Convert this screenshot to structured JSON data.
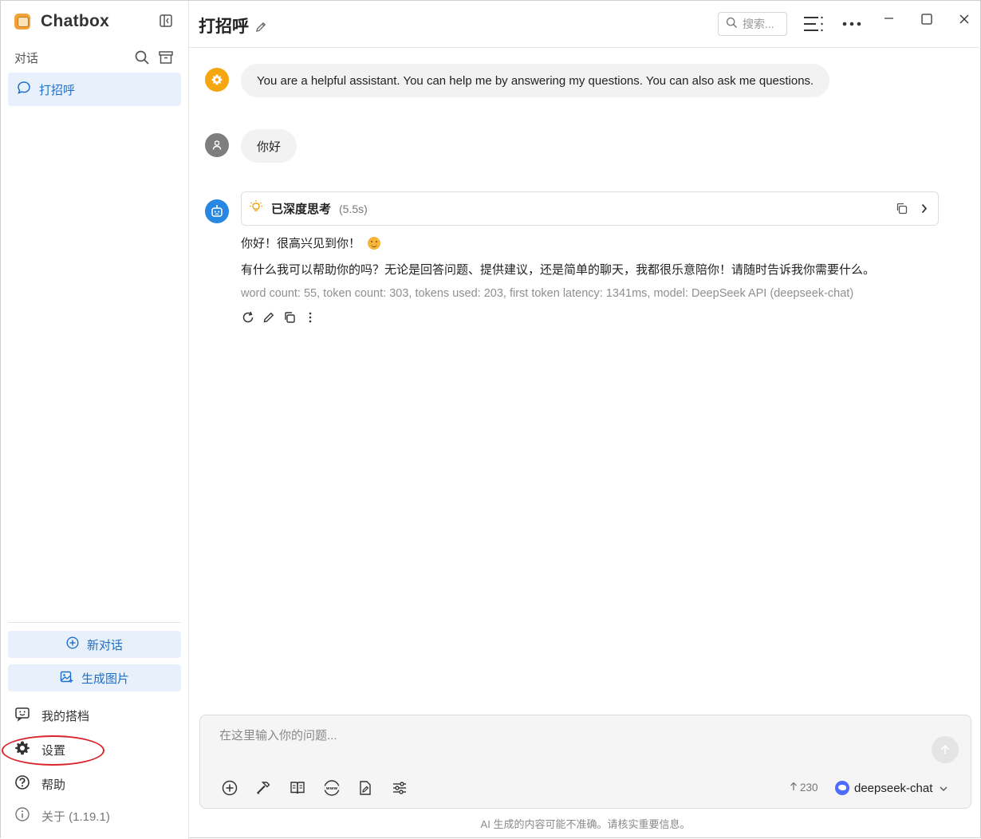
{
  "app": {
    "name": "Chatbox"
  },
  "sidebar": {
    "section_label": "对话",
    "conversations": [
      {
        "label": "打招呼",
        "active": true
      }
    ],
    "new_chat_label": "新对话",
    "generate_image_label": "生成图片",
    "menu": {
      "partners": "我的搭档",
      "settings": "设置",
      "help": "帮助",
      "about": "关于 (1.19.1)"
    }
  },
  "header": {
    "title": "打招呼",
    "search_placeholder": "搜索..."
  },
  "messages": {
    "system": "You are a helpful assistant. You can help me by answering my questions. You can also ask me questions.",
    "user": "你好",
    "assistant": {
      "thinking_label": "已深度思考",
      "thinking_time": "(5.5s)",
      "line1": "你好！很高兴见到你！",
      "line2": "有什么我可以帮助你的吗？无论是回答问题、提供建议，还是简单的聊天，我都很乐意陪你！请随时告诉我你需要什么。",
      "meta": "word count: 55, token count: 303, tokens used: 203, first token latency: 1341ms, model: DeepSeek API (deepseek-chat)"
    }
  },
  "input": {
    "placeholder": "在这里输入你的问题...",
    "token_count": "230",
    "model": "deepseek-chat"
  },
  "footer": {
    "disclaimer": "AI 生成的内容可能不准确。请核实重要信息。"
  },
  "colors": {
    "accent": "#1e6fc9",
    "accent_bg": "#e8f1fb",
    "highlight": "#d9262c"
  }
}
